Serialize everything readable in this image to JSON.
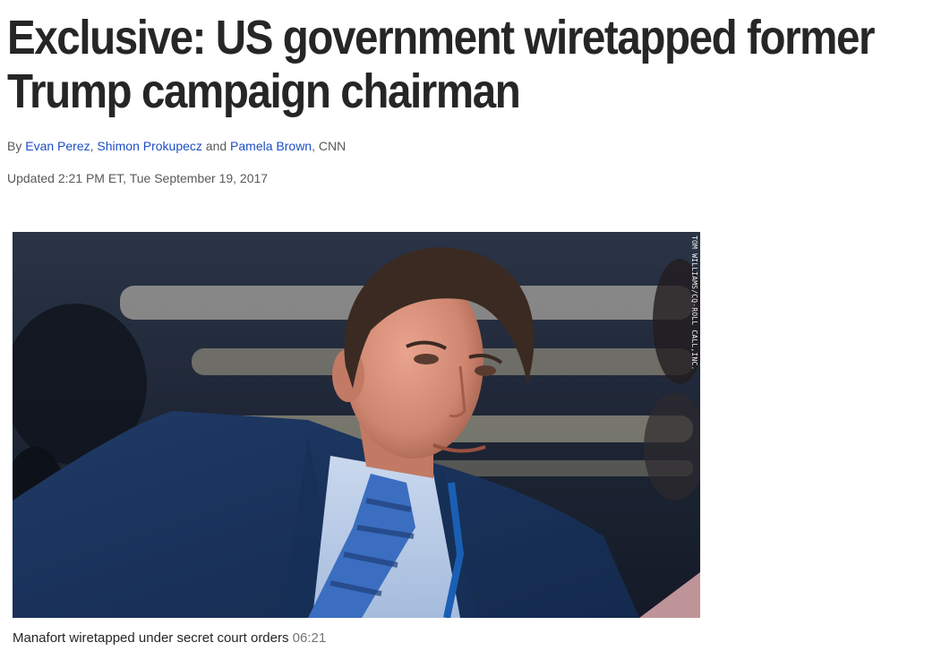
{
  "article": {
    "headline_line1": "Exclusive: US government wiretapped former",
    "headline_line2": "Trump campaign chairman",
    "byline": {
      "prefix": "By ",
      "author1": "Evan Perez",
      "sep1": ", ",
      "author2": "Shimon Prokupecz",
      "sep2": " and ",
      "author3": "Pamela Brown",
      "suffix": ", CNN"
    },
    "updated": "Updated 2:21 PM ET, Tue September 19, 2017"
  },
  "video": {
    "photo_credit": "TOM WILLIAMS/CQ-ROLL CALL,INC.",
    "caption_title": "Manafort wiretapped under secret court orders",
    "duration": "06:21"
  },
  "colors": {
    "link": "#1d4ec2",
    "headline": "#262626",
    "meta": "#595959"
  }
}
